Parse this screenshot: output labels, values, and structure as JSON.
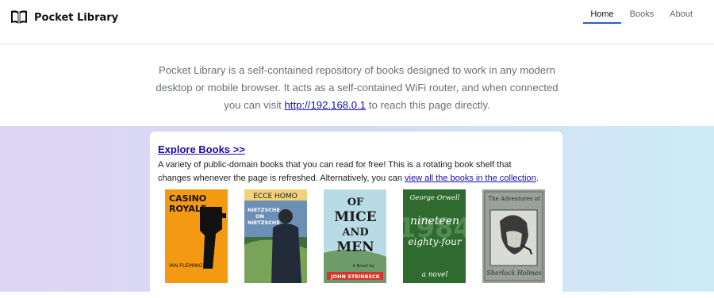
{
  "brand": {
    "name": "Pocket Library",
    "icon": "open-book-icon"
  },
  "nav": {
    "items": [
      {
        "label": "Home",
        "active": true
      },
      {
        "label": "Books",
        "active": false
      },
      {
        "label": "About",
        "active": false
      }
    ]
  },
  "intro": {
    "text_before": "Pocket Library is a self-contained repository of books designed to work in any modern desktop or mobile browser. It acts as a self-contained WiFi router, and when connected you can visit ",
    "link": "http://192.168.0.1",
    "text_after": " to reach this page directly."
  },
  "explore": {
    "title": "Explore Books >>",
    "desc_before": "A variety of public-domain books that you can read for free! This is a rotating book shelf that changes whenever the page is refreshed. Alternatively, you can ",
    "desc_link": "view all the books in the collection",
    "desc_after": "."
  },
  "books": [
    {
      "cover_lines": [
        "CASINO",
        "ROYALE"
      ],
      "author_line": "IAN FLEMING",
      "bg": "#f39a12"
    },
    {
      "cover_lines": [
        "ECCE HOMO"
      ],
      "sub_lines": [
        "NIETZSCHE",
        "ON",
        "NIETZSCHE"
      ],
      "bg": "#5b7fa6"
    },
    {
      "cover_lines": [
        "OF",
        "MICE",
        "AND",
        "MEN"
      ],
      "author_line": "JOHN STEINBECK",
      "sub_line": "A Novel by",
      "bg": "#b9dbe6"
    },
    {
      "cover_lines": [
        "George Orwell",
        "nineteen",
        "eighty-four"
      ],
      "year": "1984",
      "author_line": "a novel",
      "bg": "#2f6b2f"
    },
    {
      "cover_lines": [
        "The Adventures of"
      ],
      "author_line": "Sherlock Holmes",
      "bg": "#9aa19a"
    }
  ],
  "colors": {
    "accent": "#2a5bd7",
    "link": "#1a0dab"
  }
}
